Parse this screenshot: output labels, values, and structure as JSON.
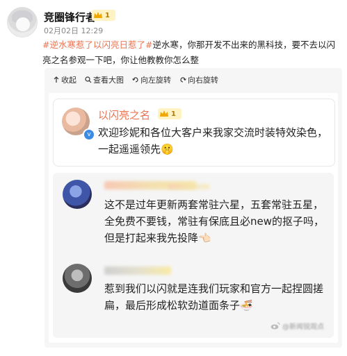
{
  "header": {
    "username": "竞圈锋行者",
    "badge_level": "1",
    "date": "02月02日",
    "time": "12:29"
  },
  "post": {
    "tag1": "#逆水寒惹了以闪亮日惹了#",
    "text": "逆水寒，你那开发不出来的黑科技，要不去以闪亮之名参观一下吧，你让他教教你怎么整"
  },
  "toolbar": {
    "collapse": "收起",
    "view_large": "查看大图",
    "rotate_left": "向左旋转",
    "rotate_right": "向右旋转"
  },
  "comment": {
    "name": "以闪亮之名",
    "badge_level": "1",
    "verified_mark": "v",
    "text": "欢迎珍妮和各位大客户来我家交流时装特效染色，一起遥遥领先🤫"
  },
  "replies": [
    {
      "text": "这不是过年更新两套常驻六星，五套常驻五星，全免费不要钱，常驻有保底且必new的抠子吗，但是打起来我先投降👈🏻"
    },
    {
      "text": "惹到我们以闪就是连我们玩家和官方一起捏圆搓扁，最后形成松软劲道面条子🍜"
    }
  ],
  "watermark": "@新闻锐观点",
  "colors": {
    "tag": "#eb7350",
    "comment_name": "#eb7350",
    "verified": "#3b8ae6",
    "badge_bg": "#fff3c4"
  }
}
